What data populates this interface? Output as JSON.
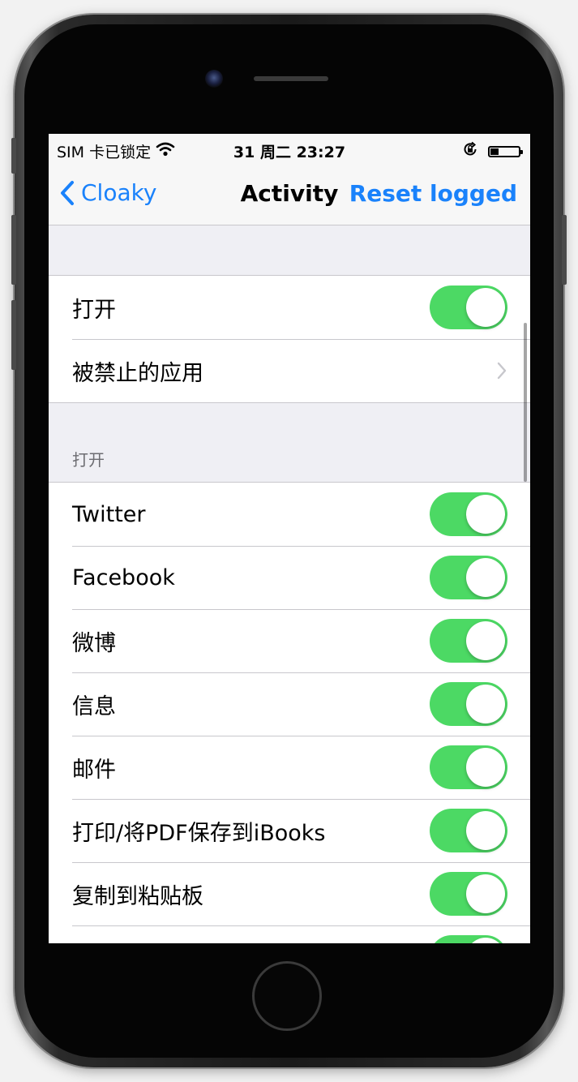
{
  "status_bar": {
    "carrier": "SIM 卡已锁定",
    "time": "31 周二 23:27",
    "battery_level": 0.3
  },
  "nav_bar": {
    "back_label": "Cloaky",
    "title": "Activity",
    "right_action": "Reset logged"
  },
  "group1": {
    "items": [
      {
        "label": "打开",
        "control": "toggle",
        "on": true
      },
      {
        "label": "被禁止的应用",
        "control": "disclosure"
      }
    ]
  },
  "section2": {
    "header": "打开",
    "items": [
      {
        "label": "Twitter",
        "on": true
      },
      {
        "label": "Facebook",
        "on": true
      },
      {
        "label": "微博",
        "on": true
      },
      {
        "label": "信息",
        "on": true
      },
      {
        "label": "邮件",
        "on": true
      },
      {
        "label": "打印/将PDF保存到iBooks",
        "on": true
      },
      {
        "label": "复制到粘贴板",
        "on": true
      },
      {
        "label": "",
        "on": true
      }
    ]
  },
  "colors": {
    "accent": "#1a82fb",
    "toggle_on": "#4cd964",
    "group_background": "#efeff4"
  }
}
